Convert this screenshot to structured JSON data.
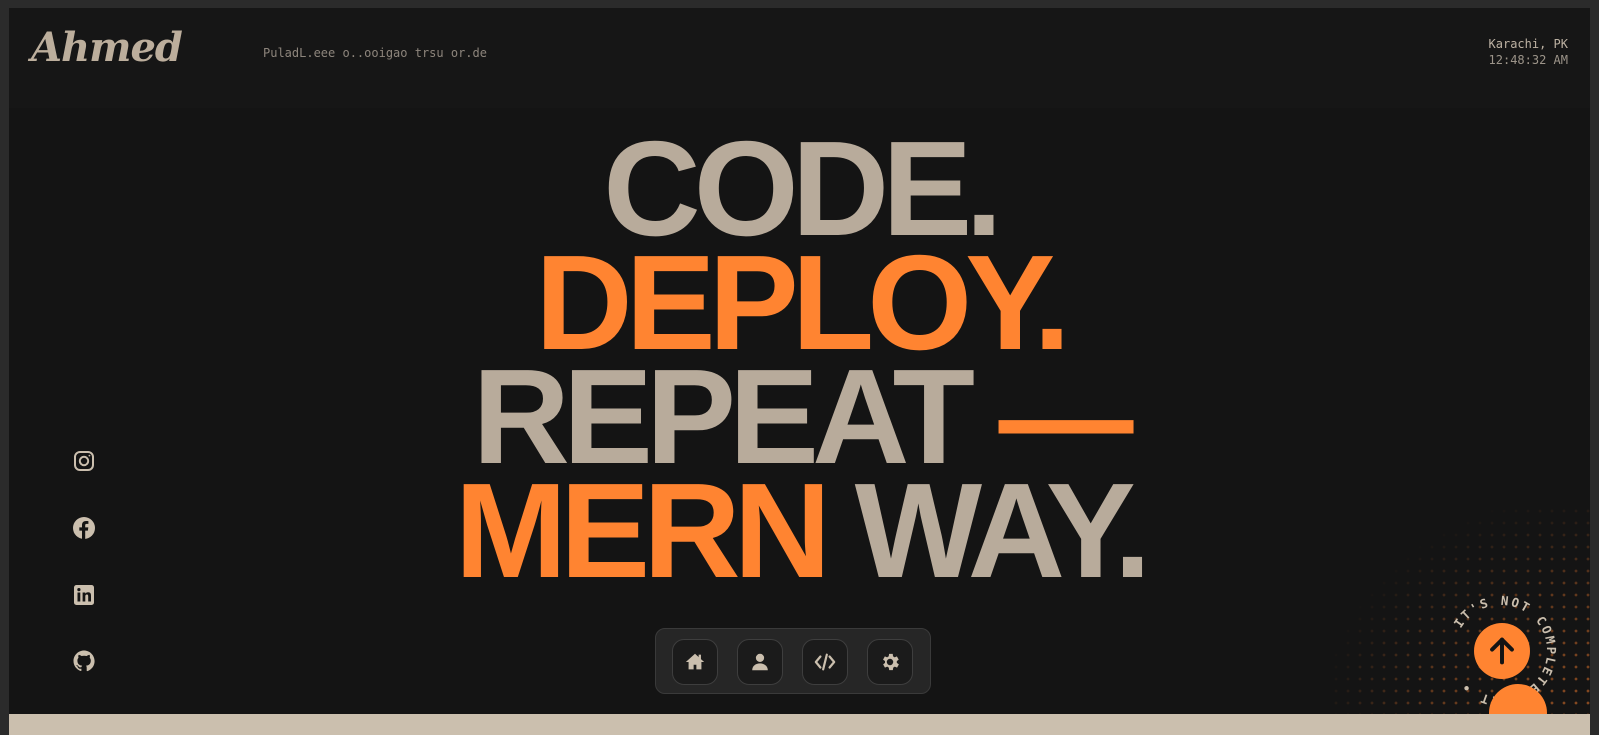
{
  "header": {
    "logo": "Ahmed",
    "tagline": "PuladL.eee o..ooigao trsu or.de",
    "location": "Karachi, PK",
    "time": "12:48:32 AM"
  },
  "hero": {
    "line1": "CODE.",
    "line2": "DEPLOY.",
    "line3_word": "REPEAT",
    "line3_dash": "—",
    "line4_accent": "MERN",
    "line4_rest": "WAY."
  },
  "social": {
    "items": [
      {
        "icon": "instagram-icon"
      },
      {
        "icon": "facebook-icon"
      },
      {
        "icon": "linkedin-icon"
      },
      {
        "icon": "github-icon"
      }
    ]
  },
  "dock": {
    "items": [
      {
        "icon": "home-icon"
      },
      {
        "icon": "user-icon"
      },
      {
        "icon": "code-icon"
      },
      {
        "icon": "gear-icon"
      }
    ]
  },
  "badge": {
    "text": "IT'S NOT COMPLETED YET • "
  },
  "colors": {
    "background": "#141414",
    "accent": "#ff8431",
    "beige": "#b8ab9b"
  }
}
